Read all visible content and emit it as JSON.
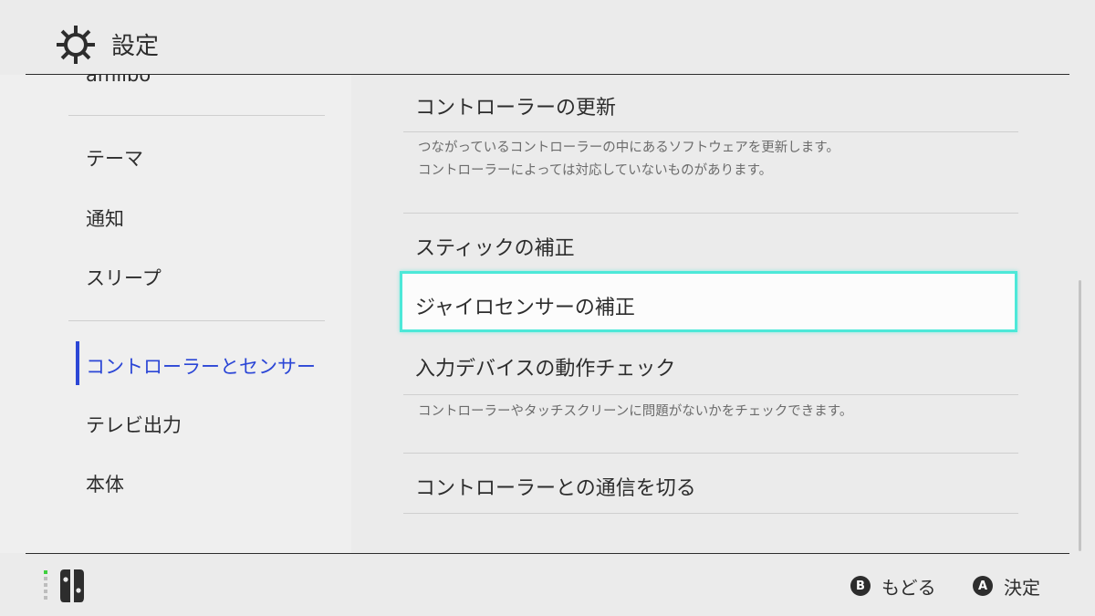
{
  "header": {
    "title": "設定",
    "icon": "gear-icon"
  },
  "sidebar": {
    "partial_item": "amiibo",
    "items": [
      {
        "label": "テーマ"
      },
      {
        "label": "通知"
      },
      {
        "label": "スリープ"
      },
      {
        "label": "コントローラーとセンサー"
      },
      {
        "label": "テレビ出力"
      },
      {
        "label": "本体"
      }
    ],
    "selected": "コントローラーとセンサー"
  },
  "main": {
    "options": [
      {
        "title": "コントローラーの更新",
        "desc": [
          "つながっているコントローラーの中にあるソフトウェアを更新します。",
          "コントローラーによっては対応していないものがあります。"
        ]
      },
      {
        "title": "スティックの補正"
      },
      {
        "title": "ジャイロセンサーの補正"
      },
      {
        "title": "入力デバイスの動作チェック",
        "desc": [
          "コントローラーやタッチスクリーンに問題がないかをチェックできます。"
        ]
      },
      {
        "title": "コントローラーとの通信を切る"
      }
    ],
    "focused": "ジャイロセンサーの補正"
  },
  "footer": {
    "controller_icon": "joycon-icon",
    "back": {
      "key": "B",
      "label": "もどる"
    },
    "confirm": {
      "key": "A",
      "label": "決定"
    }
  },
  "colors": {
    "background": "#ebebeb",
    "selected_accent": "#2b46d6",
    "focus_border": "#4de8d8",
    "text": "#2d2d2d",
    "desc_text": "#6b6b6b"
  }
}
